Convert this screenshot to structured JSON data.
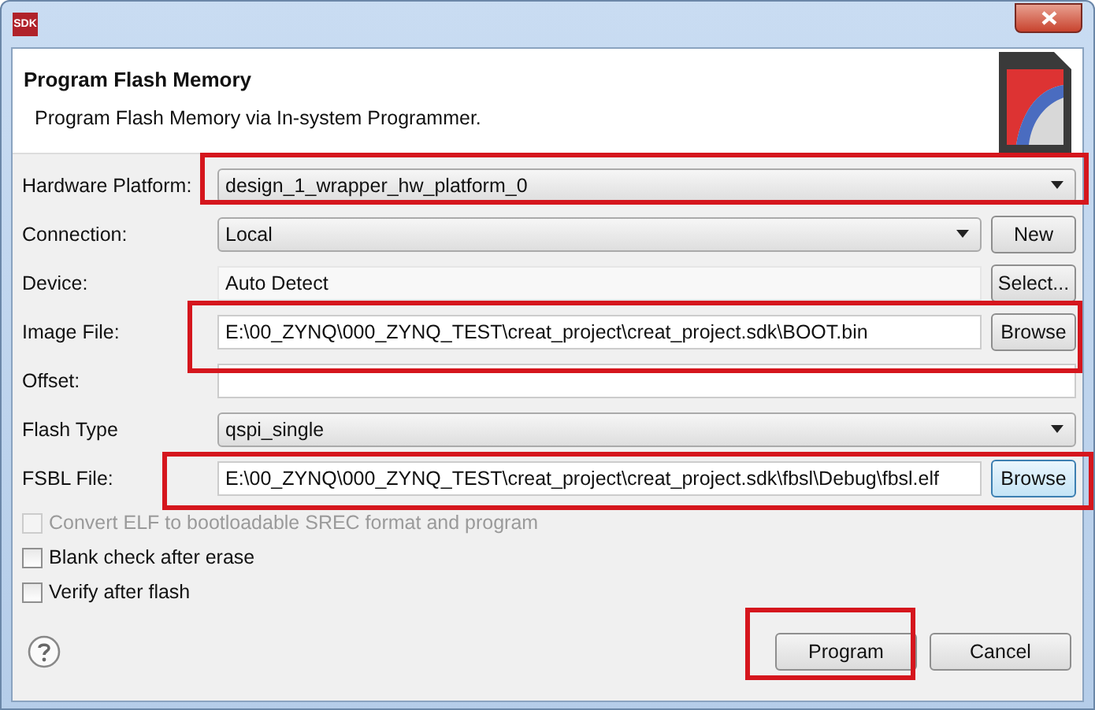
{
  "window": {
    "title_icon": "SDK"
  },
  "header": {
    "title": "Program Flash Memory",
    "subtitle": "Program Flash Memory via In-system Programmer."
  },
  "fields": [
    {
      "label": "Hardware Platform:",
      "kind": "combo",
      "value": "design_1_wrapper_hw_platform_0"
    },
    {
      "label": "Connection:",
      "kind": "combo",
      "value": "Local",
      "button": "New"
    },
    {
      "label": "Device:",
      "kind": "readonly",
      "value": "Auto Detect",
      "button": "Select..."
    },
    {
      "label": "Image File:",
      "kind": "text",
      "value": "E:\\00_ZYNQ\\000_ZYNQ_TEST\\creat_project\\creat_project.sdk\\BOOT.bin",
      "button": "Browse"
    },
    {
      "label": "Offset:",
      "kind": "text"
    },
    {
      "label": "Flash Type",
      "kind": "combo",
      "value": "qspi_single"
    },
    {
      "label": "FSBL File:",
      "kind": "text",
      "value": "E:\\00_ZYNQ\\000_ZYNQ_TEST\\creat_project\\creat_project.sdk\\fbsl\\Debug\\fbsl.elf",
      "button": "Browse",
      "button_focused": true
    }
  ],
  "options": [
    {
      "label": "Convert ELF to bootloadable SREC format and program",
      "checked": false,
      "disabled": true
    },
    {
      "label": "Blank check after erase",
      "checked": false,
      "disabled": false
    },
    {
      "label": "Verify after flash",
      "checked": false,
      "disabled": false
    }
  ],
  "buttons": [
    "Program",
    "Cancel"
  ]
}
